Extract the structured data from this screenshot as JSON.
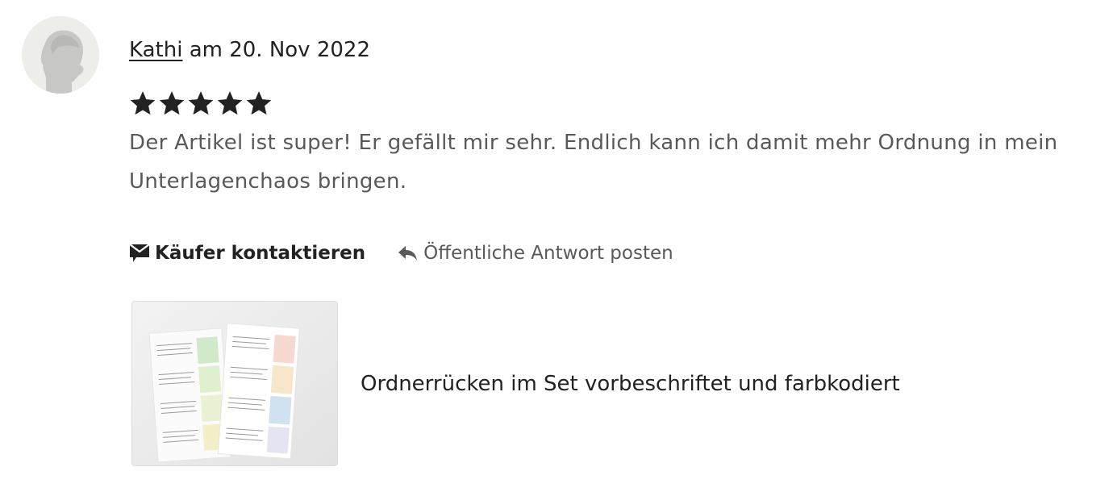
{
  "review": {
    "author": "Kathi",
    "date_text": "am 20. Nov 2022",
    "rating": 5,
    "rating_max": 5,
    "text": "Der Artikel ist super! Er gefällt mir sehr. Endlich kann ich damit mehr Ordnung in mein Unterlagenchaos bringen."
  },
  "actions": {
    "contact_label": "Käufer kontaktieren",
    "reply_label": "Öffentliche Antwort posten"
  },
  "listing": {
    "title": "Ordnerrücken im Set vorbeschriftet und farbkodiert"
  },
  "icons": {
    "avatar": "default-user-avatar",
    "contact": "envelope-icon",
    "reply": "reply-arrow-icon",
    "star": "star-icon"
  },
  "colors": {
    "text_primary": "#222222",
    "text_secondary": "#595959",
    "star": "#222222",
    "avatar_bg": "#ededea"
  }
}
